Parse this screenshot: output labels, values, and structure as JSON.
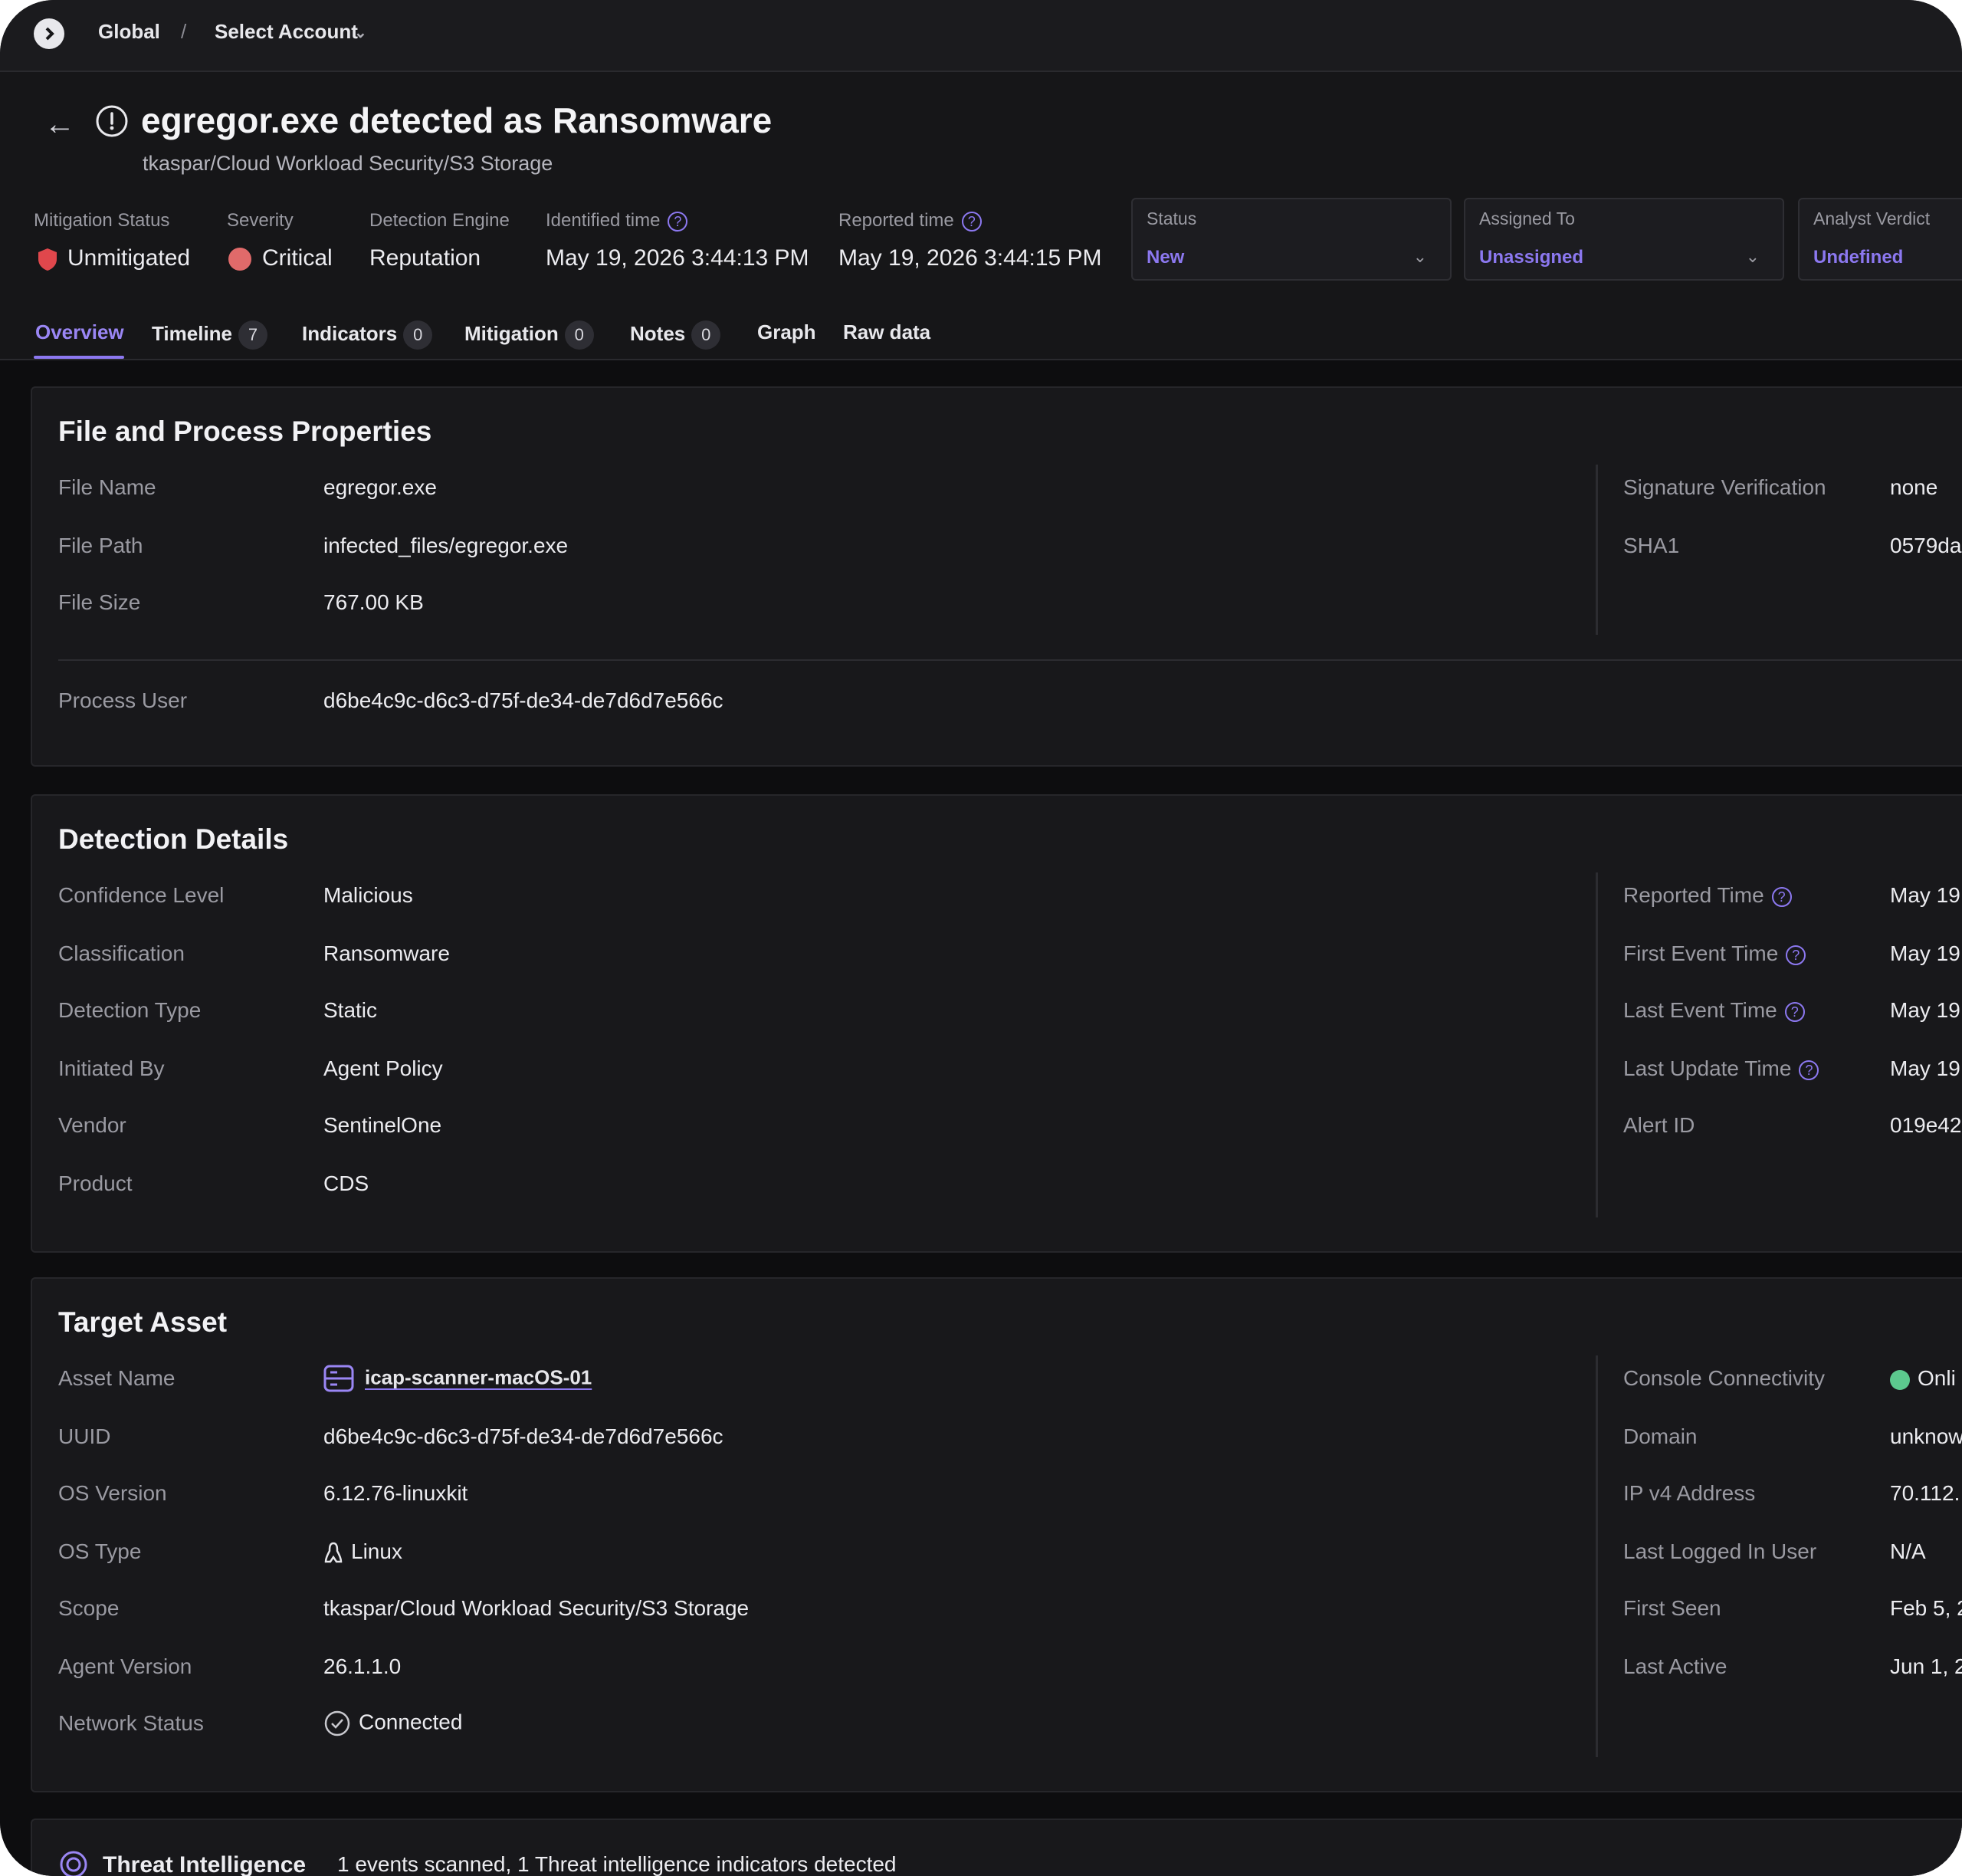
{
  "topbar": {
    "global": "Global",
    "separator": "/",
    "select_account": "Select Account"
  },
  "header": {
    "title": "egregor.exe detected as Ransomware",
    "subtitle": "tkaspar/Cloud Workload Security/S3 Storage"
  },
  "meta": {
    "mitigation_status_label": "Mitigation Status",
    "mitigation_status_value": "Unmitigated",
    "severity_label": "Severity",
    "severity_value": "Critical",
    "detection_engine_label": "Detection Engine",
    "detection_engine_value": "Reputation",
    "identified_time_label": "Identified time",
    "identified_time_value": "May 19, 2026 3:44:13 PM",
    "reported_time_label": "Reported time",
    "reported_time_value": "May 19, 2026 3:44:15 PM",
    "help_glyph": "?"
  },
  "dropdowns": {
    "status_label": "Status",
    "status_value": "New",
    "assigned_label": "Assigned To",
    "assigned_value": "Unassigned",
    "verdict_label": "Analyst Verdict",
    "verdict_value": "Undefined"
  },
  "tabs": {
    "overview": "Overview",
    "timeline": "Timeline",
    "timeline_count": "7",
    "indicators": "Indicators",
    "indicators_count": "0",
    "mitigation": "Mitigation",
    "mitigation_count": "0",
    "notes": "Notes",
    "notes_count": "0",
    "graph": "Graph",
    "raw": "Raw data"
  },
  "file_props": {
    "title": "File and Process Properties",
    "file_name_label": "File Name",
    "file_name": "egregor.exe",
    "file_path_label": "File Path",
    "file_path": "infected_files/egregor.exe",
    "file_size_label": "File Size",
    "file_size": "767.00 KB",
    "process_user_label": "Process User",
    "process_user": "d6be4c9c-d6c3-d75f-de34-de7d6d7e566c",
    "sig_label": "Signature Verification",
    "sig_value": "none",
    "sha1_label": "SHA1",
    "sha1_value": "0579da"
  },
  "detection": {
    "title": "Detection Details",
    "confidence_label": "Confidence Level",
    "confidence": "Malicious",
    "classification_label": "Classification",
    "classification": "Ransomware",
    "type_label": "Detection Type",
    "type": "Static",
    "initiated_label": "Initiated By",
    "initiated": "Agent Policy",
    "vendor_label": "Vendor",
    "vendor": "SentinelOne",
    "product_label": "Product",
    "product": "CDS",
    "reported_label": "Reported Time",
    "reported": "May 19",
    "first_event_label": "First Event Time",
    "first_event": "May 19",
    "last_event_label": "Last Event Time",
    "last_event": "May 19",
    "last_update_label": "Last Update Time",
    "last_update": "May 19",
    "alert_id_label": "Alert ID",
    "alert_id": "019e42"
  },
  "target": {
    "title": "Target Asset",
    "asset_name_label": "Asset Name",
    "asset_name": "icap-scanner-macOS-01",
    "uuid_label": "UUID",
    "uuid": "d6be4c9c-d6c3-d75f-de34-de7d6d7e566c",
    "os_version_label": "OS Version",
    "os_version": "6.12.76-linuxkit",
    "os_type_label": "OS Type",
    "os_type": "Linux",
    "scope_label": "Scope",
    "scope": "tkaspar/Cloud Workload Security/S3 Storage",
    "agent_version_label": "Agent Version",
    "agent_version": "26.1.1.0",
    "network_status_label": "Network Status",
    "network_status": "Connected",
    "console_label": "Console Connectivity",
    "console": "Onli",
    "domain_label": "Domain",
    "domain": "unknow",
    "ipv4_label": "IP v4 Address",
    "ipv4": "70.112.",
    "last_user_label": "Last Logged In User",
    "last_user": "N/A",
    "first_seen_label": "First Seen",
    "first_seen": "Feb 5, 2",
    "last_active_label": "Last Active",
    "last_active": "Jun 1, 2"
  },
  "threat_intel": {
    "title": "Threat Intelligence",
    "summary": "1 events scanned, 1 Threat intelligence indicators detected"
  },
  "colors": {
    "accent": "#8c78f0",
    "critical": "#e06a6a",
    "online": "#5cc98e",
    "background": "#161618"
  }
}
